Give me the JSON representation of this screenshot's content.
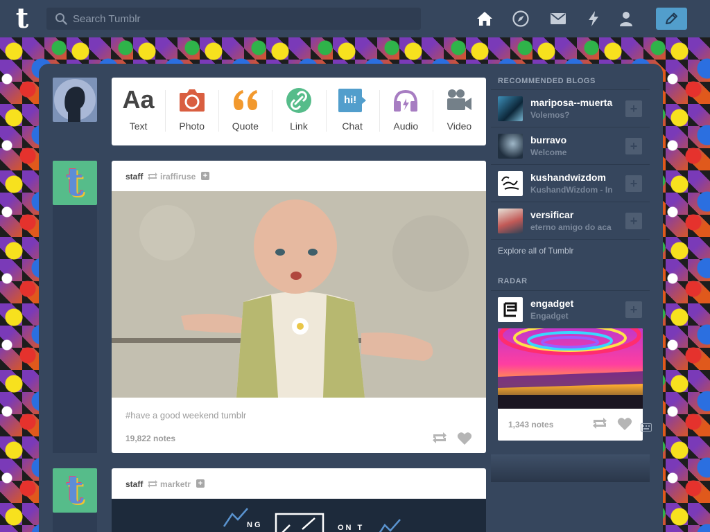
{
  "topbar": {
    "logo": "t",
    "search_placeholder": "Search Tumblr"
  },
  "post_types": [
    {
      "label": "Text",
      "icon": "text-icon",
      "glyph": "Aa"
    },
    {
      "label": "Photo",
      "icon": "camera-icon"
    },
    {
      "label": "Quote",
      "icon": "quote-icon"
    },
    {
      "label": "Link",
      "icon": "link-icon"
    },
    {
      "label": "Chat",
      "icon": "chat-icon",
      "glyph": "hi!"
    },
    {
      "label": "Audio",
      "icon": "headphones-icon"
    },
    {
      "label": "Video",
      "icon": "video-camera-icon"
    }
  ],
  "posts": [
    {
      "user": "staff",
      "source": "iraffiruse",
      "caption": "#have a good weekend tumblr",
      "notes": "19,822 notes"
    },
    {
      "user": "staff",
      "source": "marketr",
      "banner_text_left": "NG",
      "banner_text_right": "ON T"
    }
  ],
  "sidebar": {
    "recommended_title": "RECOMMENDED BLOGS",
    "recommended": [
      {
        "name": "mariposa--muerta",
        "sub": "Volemos?"
      },
      {
        "name": "burravo",
        "sub": "Welcome"
      },
      {
        "name": "kushandwizdom",
        "sub": "KushandWizdom - In"
      },
      {
        "name": "versificar",
        "sub": "eterno amigo do aca"
      }
    ],
    "explore": "Explore all of Tumblr",
    "radar_title": "RADAR",
    "radar": {
      "name": "engadget",
      "sub": "Engadget",
      "notes": "1,343 notes"
    }
  },
  "colors": {
    "brand_navy": "#36465d",
    "compose_blue": "#529ecc",
    "photo_red": "#d95e40",
    "quote_orange": "#f2992e",
    "link_green": "#56bc8a",
    "chat_blue": "#529ecc",
    "audio_purple": "#a77dc2",
    "video_gray": "#748089"
  }
}
